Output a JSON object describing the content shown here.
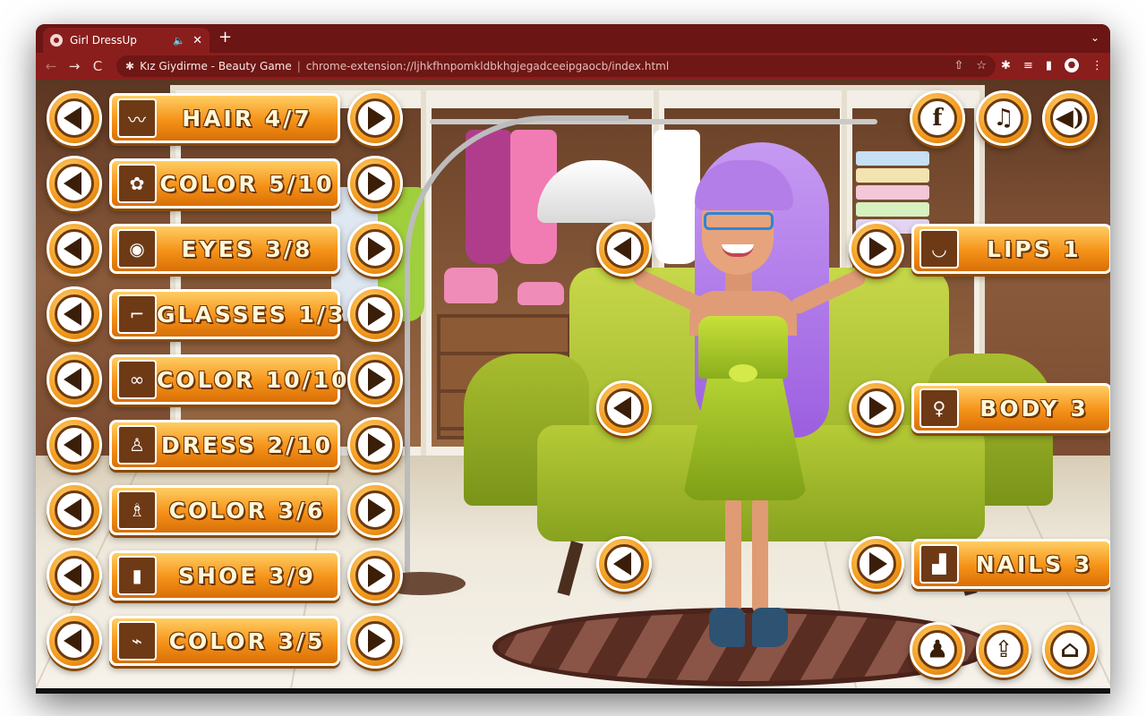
{
  "browser": {
    "tab_title": "Girl DressUp",
    "tab_audio_icon": "🔈",
    "tab_close": "✕",
    "new_tab": "+",
    "tab_menu_icon": "⌄",
    "back_icon": "←",
    "forward_icon": "→",
    "reload_icon": "C",
    "site_name": "Kız Giydirme - Beauty Game",
    "separator": "|",
    "url": "chrome-extension://ljhkfhnpomkldbkhgjegadceeipgaocb/index.html"
  },
  "game": {
    "left_controls": [
      {
        "label": "HAIR 4/7",
        "icon": "hair-icon",
        "thumb_glyph": "〰"
      },
      {
        "label": "COLOR 5/10",
        "icon": "hair-color-icon",
        "thumb_glyph": "✿"
      },
      {
        "label": "EYES 3/8",
        "icon": "eye-icon",
        "thumb_glyph": "◉"
      },
      {
        "label": "GLASSES 1/3",
        "icon": "glasses-icon",
        "thumb_glyph": "⌐"
      },
      {
        "label": "COLOR 10/10",
        "icon": "glasses-color-icon",
        "thumb_glyph": "∞"
      },
      {
        "label": "DRESS 2/10",
        "icon": "dress-icon",
        "thumb_glyph": "♙"
      },
      {
        "label": "COLOR 3/6",
        "icon": "dress-color-icon",
        "thumb_glyph": "♗"
      },
      {
        "label": "SHOE 3/9",
        "icon": "shoe-icon",
        "thumb_glyph": "▮"
      },
      {
        "label": "COLOR 3/5",
        "icon": "shoe-color-icon",
        "thumb_glyph": "⌁"
      }
    ],
    "right_controls": [
      {
        "label": "LIPS 1",
        "icon": "lips-icon",
        "thumb_glyph": "◡"
      },
      {
        "label": "BODY 3",
        "icon": "body-icon",
        "thumb_glyph": "♀"
      },
      {
        "label": "NAILS 3",
        "icon": "foot-icon",
        "thumb_glyph": "▟"
      }
    ],
    "top_right_buttons": [
      {
        "glyph": "f",
        "icon": "facebook-icon"
      },
      {
        "glyph": "♫",
        "icon": "music-icon"
      },
      {
        "glyph": "◀)",
        "icon": "sound-icon"
      }
    ],
    "bottom_right_buttons": [
      {
        "glyph": "♟",
        "icon": "avatar-icon"
      },
      {
        "glyph": "⇪",
        "icon": "share-icon"
      },
      {
        "glyph": "⌂",
        "icon": "home-icon"
      }
    ]
  }
}
